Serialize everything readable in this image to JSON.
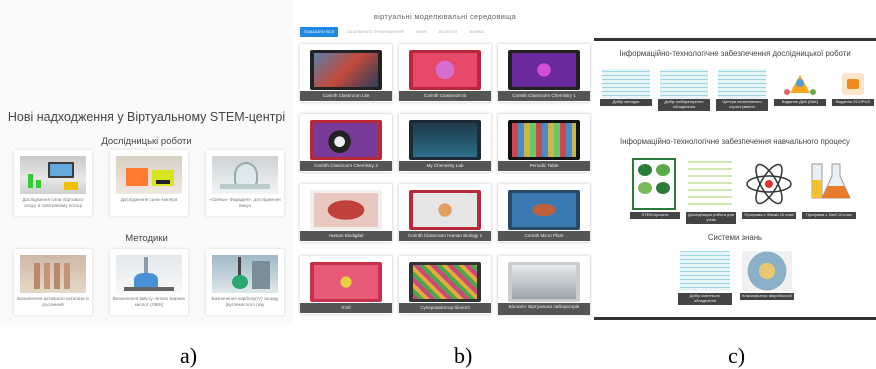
{
  "panel_a": {
    "title": "Нові надходження у Віртуальному STEM-центрі",
    "section_research": "Дослідницькі роботи",
    "section_methods": "Методики",
    "research_cards": [
      {
        "label": "Дослідження сили ліфтового опору в повітряному потоці"
      },
      {
        "label": "Дослідження сили Ампера"
      },
      {
        "label": "«Свічка» Фарадея»: дослідження вакуа"
      }
    ],
    "method_cards": [
      {
        "label": "Визначення активного каталазе в рослинній"
      },
      {
        "label": "Визначення вмісту летких жирних кислот (ЛЖК)"
      },
      {
        "label": "Визначення карбону(IV) оксиду (вуглекислого газу"
      }
    ]
  },
  "panel_b": {
    "title": "віртуальні моделювальні середовища",
    "tabs": [
      "ПОКАЗАТИ ВСЕ",
      "ЗАГАЛЬНОГО ПРИЗНАЧЕННЯ",
      "ХІМІЯ",
      "БІОЛОГІЯ",
      "ФІЗИКА"
    ],
    "tiles": [
      "Corinth Classroom Lite",
      "Corinth Classroom B",
      "Corinth Classroom Chemistry 1",
      "Corinth Classroom Chemistry 2",
      "My Chemistry Lab",
      "Periodic Table",
      "Human Biodigital",
      "Corinth Classroom Human Biology 1",
      "Corinth Micro Plant",
      "iCell",
      "Супернавігатор біології",
      "Біологія: Віртуальна лабораторія"
    ]
  },
  "panel_c": {
    "section_1": "Інформаційно-технологічне забезпечення дослідницької роботи",
    "section_2": "Інформаційно-технологічне забезпечення навчального процесу",
    "section_3": "Системи знань",
    "row1": [
      "Добір методик",
      "Добір лабораторного обладнання",
      "Центри колективного користування",
      "Видання ДАК (ВАК)",
      "Видання SCOPUS"
    ],
    "row2": [
      "STEM-проєкти",
      "Дослідницькі роботи для учнів",
      "Програма з Фізики 10 клас",
      "Програма з Хімії 10 клас"
    ],
    "row3": [
      "Добір освітнього обладнання",
      "Класифікатор мікробіології"
    ]
  },
  "captions": {
    "a": "a)",
    "b": "b)",
    "c": "c)"
  }
}
